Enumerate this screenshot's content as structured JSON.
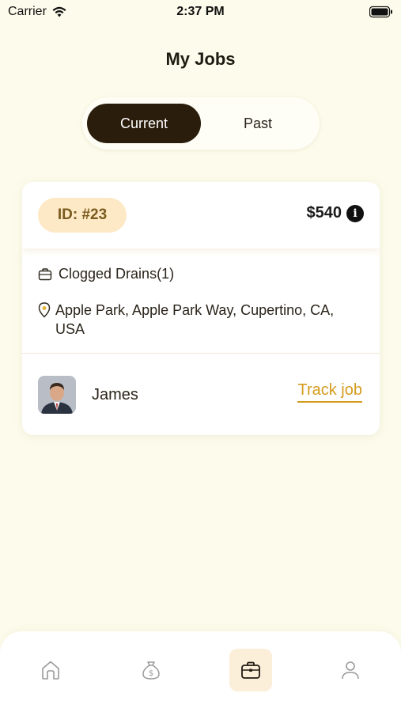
{
  "status_bar": {
    "carrier": "Carrier",
    "time": "2:37 PM"
  },
  "page": {
    "title": "My Jobs"
  },
  "segmented": {
    "current_label": "Current",
    "past_label": "Past",
    "selected": "Current"
  },
  "job": {
    "id_label": "ID: #23",
    "price": "$540",
    "service": "Clogged Drains(1)",
    "address": "Apple Park, Apple Park Way, Cupertino, CA, USA",
    "worker_name": "James",
    "track_label": "Track job"
  },
  "tab_bar": {
    "items": [
      {
        "icon": "home-icon"
      },
      {
        "icon": "money-bag-icon"
      },
      {
        "icon": "briefcase-icon",
        "active": true
      },
      {
        "icon": "person-icon"
      }
    ]
  },
  "colors": {
    "background": "#fdfcec",
    "accent": "#d69b1f",
    "dark": "#2a1d0b",
    "badge_bg": "#fde9c5",
    "badge_text": "#7a5a1e"
  }
}
